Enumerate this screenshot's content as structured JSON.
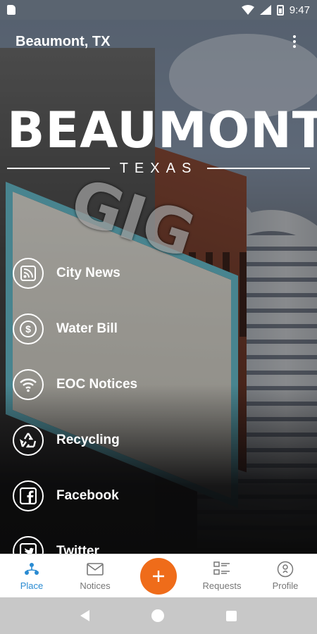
{
  "status_bar": {
    "time": "9:47"
  },
  "app_bar": {
    "location": "Beaumont, TX"
  },
  "logo": {
    "word": "BEAUMONT",
    "sub": "TEXAS"
  },
  "background_sign": {
    "big": "GIG"
  },
  "menu": [
    {
      "label": "City News",
      "icon": "rss-icon"
    },
    {
      "label": "Water Bill",
      "icon": "dollar-coin-icon"
    },
    {
      "label": "EOC Notices",
      "icon": "wifi-icon"
    },
    {
      "label": "Recycling",
      "icon": "recycle-icon"
    },
    {
      "label": "Facebook",
      "icon": "facebook-icon"
    },
    {
      "label": "Twitter",
      "icon": "twitter-icon"
    }
  ],
  "bottom_nav": {
    "place": "Place",
    "notices": "Notices",
    "requests": "Requests",
    "profile": "Profile",
    "active": "Place"
  },
  "colors": {
    "accent": "#ef6c1a",
    "active_tab": "#2a8bd2"
  }
}
